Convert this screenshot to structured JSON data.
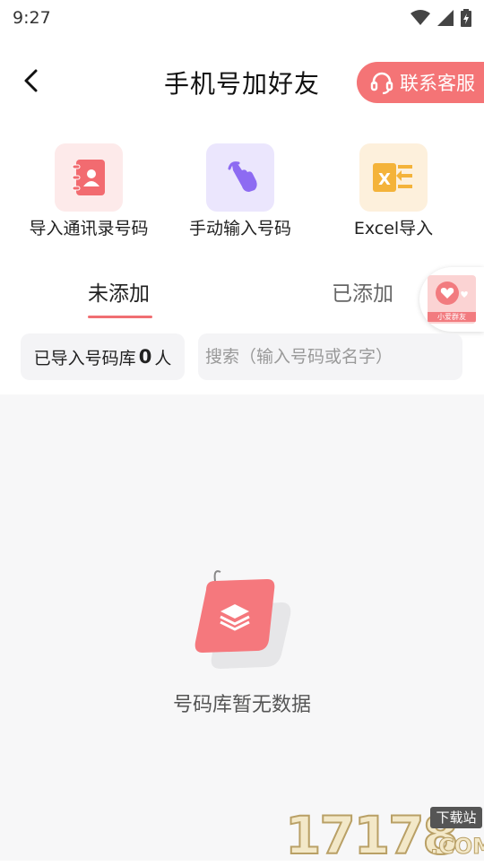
{
  "status": {
    "time": "9:27"
  },
  "header": {
    "title": "手机号加好友",
    "service_label": "联系客服"
  },
  "actions": [
    {
      "label": "导入通讯录号码",
      "icon": "contacts-book-icon",
      "color": "#f26b70",
      "bg": "#fdeaea"
    },
    {
      "label": "手动输入号码",
      "icon": "hand-tap-icon",
      "color": "#8d6bf2",
      "bg": "#ebe6fd"
    },
    {
      "label": "Excel导入",
      "icon": "excel-import-icon",
      "color": "#f4b33a",
      "bg": "#fdf0dc"
    }
  ],
  "tabs": [
    {
      "label": "未添加",
      "active": true
    },
    {
      "label": "已添加",
      "active": false
    }
  ],
  "float_badge": {
    "label": "小爱群友"
  },
  "count": {
    "prefix": "已导入号码库",
    "value": "0",
    "suffix": "人"
  },
  "search": {
    "placeholder": "搜索（输入号码或名字）"
  },
  "empty": {
    "text": "号码库暂无数据"
  },
  "watermark": {
    "digits": "17178",
    "tag": "下载站",
    "domain": ".COM"
  },
  "colors": {
    "accent": "#f47476",
    "underline": "#f06e72"
  }
}
